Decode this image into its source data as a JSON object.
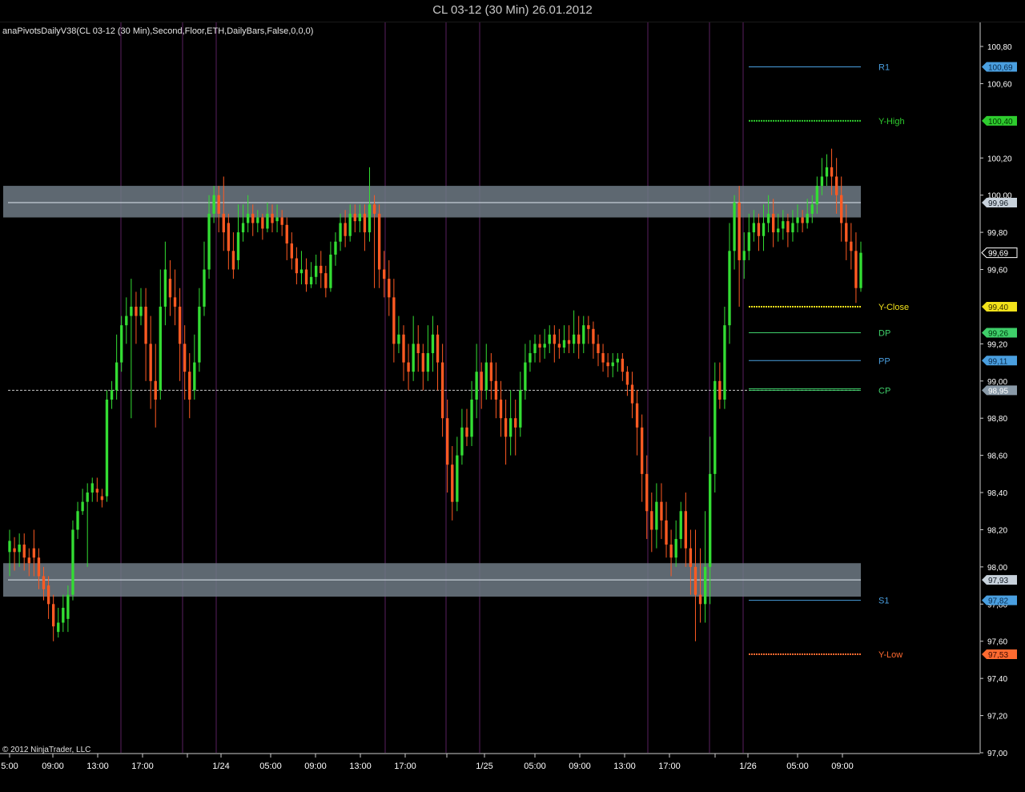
{
  "window": {
    "title": "CL 03-12 (30 Min)  26.01.2012"
  },
  "indicator_label": "anaPivotsDailyV38(CL 03-12 (30 Min),Second,Floor,ETH,DailyBars,False,0,0,0)",
  "copyright": "© 2012 NinjaTrader, LLC",
  "colors": {
    "background": "#000000",
    "up_candle": "#33dd33",
    "down_candle": "#ff5a22",
    "session_line": "#5a1f60",
    "zone_fill": "#6f7a85",
    "r1": "#4a9fe0",
    "y_high": "#2ecc2e",
    "y_close": "#f2e21b",
    "dp": "#3fcf6a",
    "pp": "#4a9fe0",
    "cp": "#3fcf6a",
    "s1": "#4a9fe0",
    "y_low": "#ff6a30"
  },
  "chart_data": {
    "type": "candlestick",
    "instrument": "CL 03-12",
    "interval": "30 Min",
    "ylim": [
      97.0,
      100.8
    ],
    "y_ticks": [
      "100,80",
      "100,60",
      "100,20",
      "100,00",
      "99,80",
      "99,60",
      "99,20",
      "99,00",
      "98,80",
      "98,60",
      "98,40",
      "98,20",
      "98,00",
      "97,80",
      "97,60",
      "97,40",
      "97,20",
      "97,00"
    ],
    "x_ticks": [
      "5:00",
      "09:00",
      "13:00",
      "17:00",
      "1/24",
      "05:00",
      "09:00",
      "13:00",
      "17:00",
      "1/25",
      "05:00",
      "09:00",
      "13:00",
      "17:00",
      "1/26",
      "05:00",
      "09:00"
    ],
    "support_resistance_zones": [
      {
        "low": 99.88,
        "high": 100.05,
        "line": 99.96,
        "label": "99,96"
      },
      {
        "low": 97.84,
        "high": 98.02,
        "line": 97.93,
        "label": "97,93"
      }
    ],
    "reference_line": {
      "value": 98.95,
      "label": "98,95"
    },
    "last_price_label": "99,69",
    "pivot_levels": [
      {
        "name": "R1",
        "value": 100.69,
        "label": "100,69",
        "style": "solid"
      },
      {
        "name": "Y-High",
        "value": 100.4,
        "label": "100,40",
        "style": "dotted"
      },
      {
        "name": "Y-Close",
        "value": 99.4,
        "label": "99,40",
        "style": "dotted"
      },
      {
        "name": "DP",
        "value": 99.26,
        "label": "99,26",
        "style": "solid"
      },
      {
        "name": "PP",
        "value": 99.11,
        "label": "99,11",
        "style": "solid"
      },
      {
        "name": "CP",
        "value": 98.95,
        "label": "98,95",
        "style": "double"
      },
      {
        "name": "S1",
        "value": 97.82,
        "label": "97,82",
        "style": "solid"
      },
      {
        "name": "Y-Low",
        "value": 97.53,
        "label": "97,53",
        "style": "dotted"
      }
    ],
    "candles": [
      [
        98.08,
        98.14,
        97.95,
        98.2
      ],
      [
        98.1,
        98.08,
        97.98,
        98.16
      ],
      [
        98.08,
        98.12,
        98.0,
        98.18
      ],
      [
        98.12,
        98.05,
        97.98,
        98.18
      ],
      [
        98.05,
        98.02,
        97.95,
        98.1
      ],
      [
        98.1,
        98.05,
        97.95,
        98.2
      ],
      [
        98.05,
        97.95,
        97.88,
        98.1
      ],
      [
        97.95,
        97.88,
        97.82,
        98.0
      ],
      [
        97.9,
        97.8,
        97.72,
        97.95
      ],
      [
        97.8,
        97.68,
        97.6,
        97.85
      ],
      [
        97.65,
        97.7,
        97.62,
        97.78
      ],
      [
        97.7,
        97.78,
        97.65,
        97.85
      ],
      [
        97.72,
        97.85,
        97.65,
        97.9
      ],
      [
        97.85,
        98.2,
        97.82,
        98.25
      ],
      [
        98.2,
        98.3,
        98.15,
        98.35
      ],
      [
        98.3,
        98.35,
        98.28,
        98.42
      ],
      [
        98.35,
        98.4,
        98.0,
        98.45
      ],
      [
        98.4,
        98.45,
        98.35,
        98.48
      ],
      [
        98.42,
        98.4,
        98.35,
        98.48
      ],
      [
        98.38,
        98.36,
        98.32,
        98.42
      ],
      [
        98.38,
        98.9,
        98.35,
        98.95
      ],
      [
        98.9,
        98.95,
        98.85,
        99.0
      ],
      [
        98.95,
        99.1,
        98.9,
        99.25
      ],
      [
        99.1,
        99.3,
        99.05,
        99.35
      ],
      [
        99.3,
        99.35,
        99.2,
        99.45
      ],
      [
        99.35,
        99.4,
        98.8,
        99.55
      ],
      [
        99.4,
        99.35,
        99.2,
        99.48
      ],
      [
        99.35,
        99.4,
        99.3,
        99.5
      ],
      [
        99.4,
        99.2,
        99.0,
        99.5
      ],
      [
        99.2,
        99.0,
        98.85,
        99.35
      ],
      [
        99.0,
        98.9,
        98.75,
        99.2
      ],
      [
        98.95,
        99.4,
        98.9,
        99.6
      ],
      [
        99.4,
        99.6,
        99.3,
        99.75
      ],
      [
        99.55,
        99.45,
        99.35,
        99.65
      ],
      [
        99.45,
        99.4,
        99.3,
        99.6
      ],
      [
        99.4,
        99.2,
        99.0,
        99.5
      ],
      [
        99.2,
        99.05,
        98.9,
        99.3
      ],
      [
        99.05,
        98.9,
        98.8,
        99.15
      ],
      [
        98.95,
        99.1,
        98.9,
        99.25
      ],
      [
        99.1,
        99.4,
        99.05,
        99.5
      ],
      [
        99.4,
        99.6,
        99.35,
        99.75
      ],
      [
        99.6,
        99.9,
        99.55,
        100.0
      ],
      [
        99.9,
        100.0,
        99.85,
        100.05
      ],
      [
        100.0,
        99.9,
        99.8,
        100.05
      ],
      [
        99.9,
        99.8,
        99.7,
        100.1
      ],
      [
        99.85,
        99.7,
        99.6,
        99.9
      ],
      [
        99.7,
        99.6,
        99.55,
        99.8
      ],
      [
        99.65,
        99.8,
        99.6,
        99.95
      ],
      [
        99.8,
        99.85,
        99.75,
        99.95
      ],
      [
        99.85,
        99.9,
        99.8,
        100.0
      ],
      [
        99.9,
        99.85,
        99.78,
        99.95
      ],
      [
        99.85,
        99.88,
        99.8,
        99.92
      ],
      [
        99.88,
        99.82,
        99.76,
        99.9
      ],
      [
        99.82,
        99.9,
        99.8,
        99.96
      ],
      [
        99.9,
        99.85,
        99.8,
        99.95
      ],
      [
        99.86,
        99.88,
        99.8,
        99.95
      ],
      [
        99.88,
        99.84,
        99.78,
        99.92
      ],
      [
        99.84,
        99.74,
        99.65,
        99.88
      ],
      [
        99.74,
        99.66,
        99.6,
        99.8
      ],
      [
        99.66,
        99.58,
        99.52,
        99.72
      ],
      [
        99.58,
        99.6,
        99.52,
        99.7
      ],
      [
        99.6,
        99.52,
        99.48,
        99.66
      ],
      [
        99.52,
        99.56,
        99.5,
        99.64
      ],
      [
        99.56,
        99.62,
        99.52,
        99.68
      ],
      [
        99.62,
        99.58,
        99.5,
        99.7
      ],
      [
        99.58,
        99.5,
        99.45,
        99.62
      ],
      [
        99.5,
        99.68,
        99.48,
        99.75
      ],
      [
        99.68,
        99.75,
        99.62,
        99.8
      ],
      [
        99.75,
        99.85,
        99.7,
        99.9
      ],
      [
        99.85,
        99.78,
        99.72,
        99.92
      ],
      [
        99.78,
        99.9,
        99.75,
        99.95
      ],
      [
        99.9,
        99.86,
        99.8,
        99.95
      ],
      [
        99.86,
        99.9,
        99.8,
        99.95
      ],
      [
        99.9,
        99.8,
        99.7,
        99.95
      ],
      [
        99.8,
        99.95,
        99.75,
        100.15
      ],
      [
        99.95,
        99.9,
        99.5,
        100.0
      ],
      [
        99.9,
        99.6,
        99.5,
        99.95
      ],
      [
        99.6,
        99.55,
        99.45,
        99.7
      ],
      [
        99.55,
        99.45,
        99.35,
        99.65
      ],
      [
        99.45,
        99.2,
        99.1,
        99.55
      ],
      [
        99.2,
        99.25,
        99.15,
        99.35
      ],
      [
        99.25,
        99.1,
        99.0,
        99.3
      ],
      [
        99.1,
        99.05,
        98.95,
        99.2
      ],
      [
        99.05,
        99.2,
        99.0,
        99.35
      ],
      [
        99.2,
        99.15,
        99.05,
        99.3
      ],
      [
        99.15,
        99.05,
        98.95,
        99.2
      ],
      [
        99.05,
        99.15,
        99.0,
        99.3
      ],
      [
        99.15,
        99.25,
        99.05,
        99.35
      ],
      [
        99.25,
        99.1,
        98.95,
        99.3
      ],
      [
        99.1,
        98.8,
        98.7,
        99.2
      ],
      [
        98.8,
        98.55,
        98.4,
        98.9
      ],
      [
        98.55,
        98.35,
        98.25,
        98.65
      ],
      [
        98.35,
        98.6,
        98.3,
        98.7
      ],
      [
        98.6,
        98.75,
        98.55,
        98.85
      ],
      [
        98.75,
        98.7,
        98.65,
        98.85
      ],
      [
        98.7,
        98.9,
        98.65,
        99.0
      ],
      [
        98.9,
        99.05,
        98.8,
        99.2
      ],
      [
        99.05,
        98.95,
        98.85,
        99.1
      ],
      [
        98.95,
        99.1,
        98.9,
        99.2
      ],
      [
        99.1,
        99.0,
        98.9,
        99.15
      ],
      [
        99.0,
        98.9,
        98.8,
        99.1
      ],
      [
        98.9,
        98.8,
        98.7,
        99.0
      ],
      [
        98.8,
        98.7,
        98.55,
        98.9
      ],
      [
        98.7,
        98.8,
        98.6,
        98.95
      ],
      [
        98.8,
        98.75,
        98.6,
        98.9
      ],
      [
        98.75,
        98.95,
        98.7,
        99.05
      ],
      [
        98.95,
        99.1,
        98.9,
        99.2
      ],
      [
        99.1,
        99.15,
        99.05,
        99.22
      ],
      [
        99.15,
        99.2,
        99.1,
        99.25
      ],
      [
        99.2,
        99.18,
        99.1,
        99.25
      ],
      [
        99.18,
        99.2,
        99.12,
        99.28
      ],
      [
        99.2,
        99.25,
        99.15,
        99.3
      ],
      [
        99.25,
        99.2,
        99.1,
        99.3
      ],
      [
        99.2,
        99.18,
        99.12,
        99.28
      ],
      [
        99.18,
        99.22,
        99.15,
        99.3
      ],
      [
        99.22,
        99.2,
        99.15,
        99.3
      ],
      [
        99.2,
        99.25,
        99.15,
        99.38
      ],
      [
        99.25,
        99.2,
        99.12,
        99.35
      ],
      [
        99.2,
        99.3,
        99.15,
        99.35
      ],
      [
        99.3,
        99.28,
        99.2,
        99.35
      ],
      [
        99.28,
        99.2,
        99.12,
        99.32
      ],
      [
        99.2,
        99.15,
        99.08,
        99.25
      ],
      [
        99.15,
        99.1,
        99.05,
        99.2
      ],
      [
        99.1,
        99.08,
        99.02,
        99.15
      ],
      [
        99.08,
        99.1,
        99.02,
        99.15
      ],
      [
        99.1,
        99.12,
        99.05,
        99.15
      ],
      [
        99.12,
        99.05,
        99.0,
        99.15
      ],
      [
        99.05,
        98.98,
        98.92,
        99.08
      ],
      [
        98.98,
        98.88,
        98.8,
        99.05
      ],
      [
        98.88,
        98.75,
        98.6,
        98.95
      ],
      [
        98.75,
        98.5,
        98.35,
        98.82
      ],
      [
        98.5,
        98.3,
        98.15,
        98.6
      ],
      [
        98.3,
        98.2,
        98.08,
        98.4
      ],
      [
        98.2,
        98.35,
        98.1,
        98.45
      ],
      [
        98.35,
        98.25,
        98.15,
        98.45
      ],
      [
        98.25,
        98.12,
        98.05,
        98.35
      ],
      [
        98.12,
        98.05,
        97.95,
        98.2
      ],
      [
        98.05,
        98.15,
        98.0,
        98.25
      ],
      [
        98.15,
        98.3,
        98.1,
        98.35
      ],
      [
        98.3,
        98.1,
        98.0,
        98.4
      ],
      [
        98.1,
        98.0,
        97.85,
        98.2
      ],
      [
        98.0,
        97.85,
        97.6,
        98.2
      ],
      [
        97.85,
        97.8,
        97.7,
        98.1
      ],
      [
        97.8,
        98.0,
        97.7,
        98.3
      ],
      [
        98.0,
        98.5,
        97.8,
        98.7
      ],
      [
        98.5,
        99.0,
        98.4,
        99.1
      ],
      [
        99.0,
        98.9,
        98.85,
        99.1
      ],
      [
        98.9,
        99.3,
        98.85,
        99.4
      ],
      [
        99.3,
        99.7,
        99.2,
        99.85
      ],
      [
        99.7,
        99.96,
        99.6,
        100.0
      ],
      [
        99.96,
        99.65,
        99.4,
        100.05
      ],
      [
        99.65,
        99.7,
        99.55,
        99.8
      ],
      [
        99.7,
        99.8,
        99.65,
        99.9
      ],
      [
        99.8,
        99.85,
        99.75,
        99.92
      ],
      [
        99.85,
        99.78,
        99.7,
        99.9
      ],
      [
        99.78,
        99.85,
        99.7,
        99.95
      ],
      [
        99.85,
        99.9,
        99.8,
        100.0
      ],
      [
        99.9,
        99.8,
        99.72,
        99.98
      ],
      [
        99.8,
        99.82,
        99.75,
        99.9
      ],
      [
        99.82,
        99.86,
        99.76,
        99.92
      ],
      [
        99.86,
        99.8,
        99.72,
        99.9
      ],
      [
        99.8,
        99.85,
        99.75,
        99.92
      ],
      [
        99.85,
        99.88,
        99.8,
        99.95
      ],
      [
        99.88,
        99.85,
        99.8,
        99.92
      ],
      [
        99.85,
        99.9,
        99.82,
        99.98
      ],
      [
        99.9,
        99.95,
        99.85,
        100.0
      ],
      [
        99.95,
        100.05,
        99.9,
        100.1
      ],
      [
        100.05,
        100.1,
        100.0,
        100.2
      ],
      [
        100.1,
        100.15,
        100.05,
        100.22
      ],
      [
        100.15,
        100.1,
        100.0,
        100.25
      ],
      [
        100.1,
        100.0,
        99.9,
        100.2
      ],
      [
        100.0,
        99.85,
        99.75,
        100.1
      ],
      [
        99.85,
        99.75,
        99.65,
        99.95
      ],
      [
        99.75,
        99.7,
        99.6,
        99.85
      ],
      [
        99.7,
        99.5,
        99.42,
        99.8
      ],
      [
        99.5,
        99.69,
        99.48,
        99.75
      ]
    ]
  }
}
